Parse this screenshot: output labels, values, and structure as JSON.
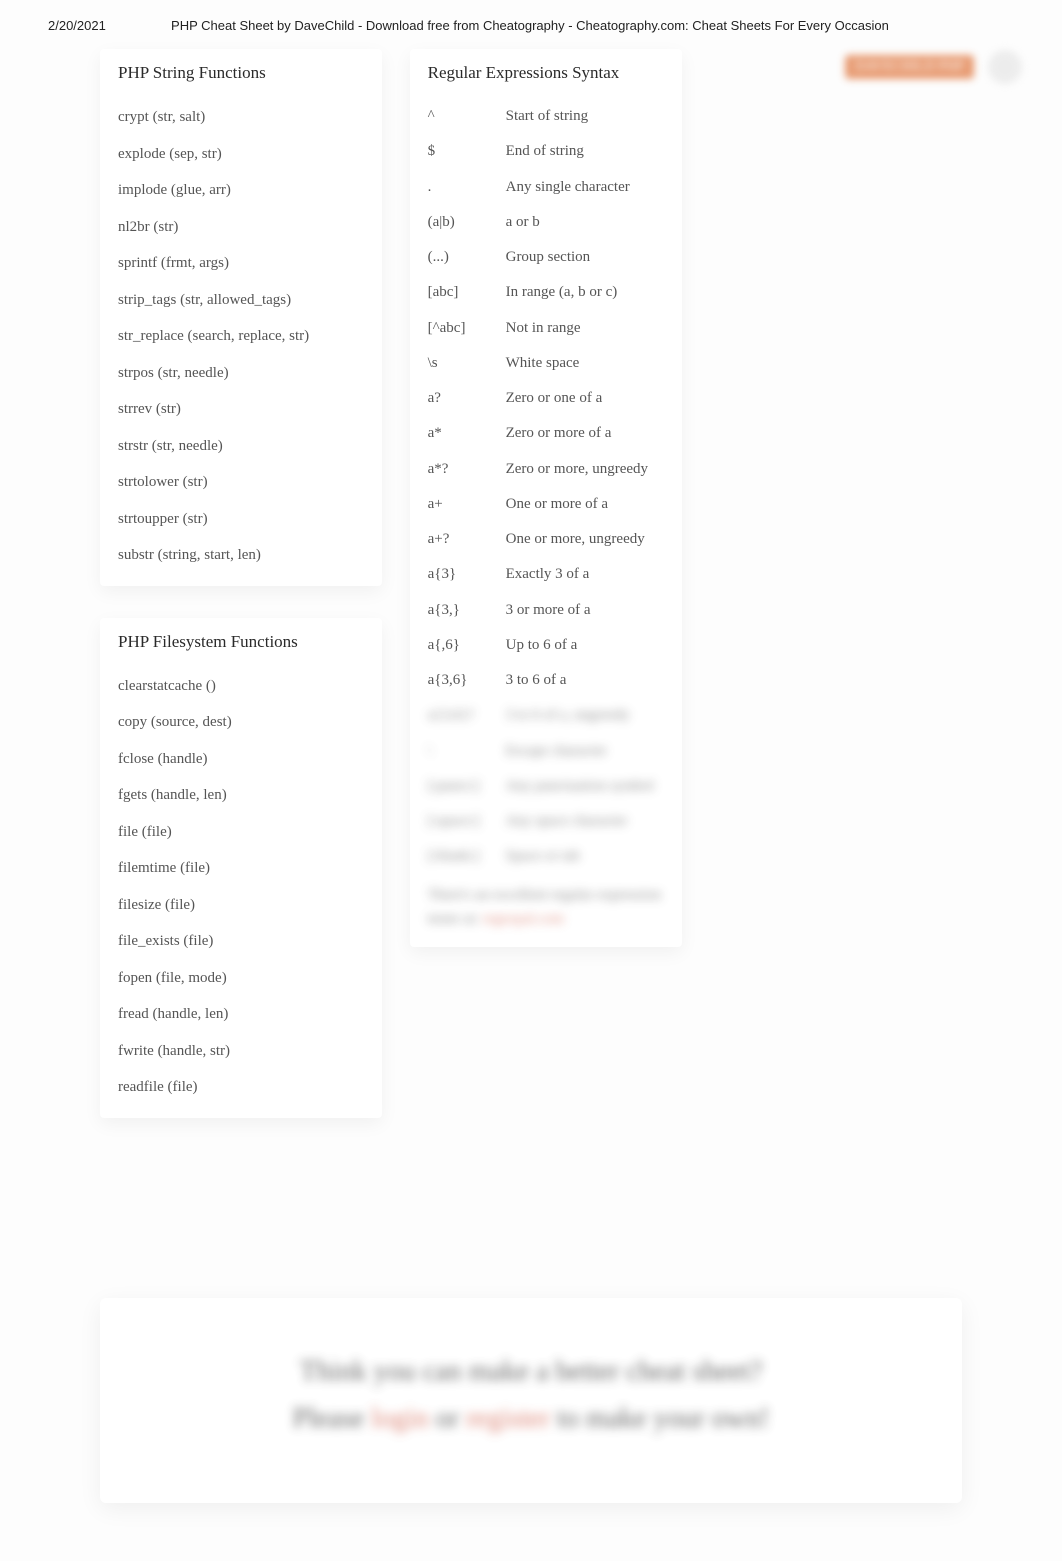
{
  "header": {
    "date": "2/20/2021",
    "title": "PHP Cheat Sheet by DaveChild - Download free from Cheatography - Cheatography.com: Cheat Sheets For Every Occasion"
  },
  "top_right_pill": "DAVECHILD PHP",
  "string_functions": {
    "title": "PHP String Functions",
    "items": [
      "crypt (str, salt)",
      "explode (sep, str)",
      "implode (glue, arr)",
      "nl2br (str)",
      "sprintf (frmt, args)",
      "strip_tags (str, allowed_tags)",
      "str_replace (search, replace, str)",
      "strpos (str, needle)",
      "strrev (str)",
      "strstr (str, needle)",
      "strtolower (str)",
      "strtoupper (str)",
      "substr (string, start, len)"
    ]
  },
  "filesystem_functions": {
    "title": "PHP Filesystem Functions",
    "items": [
      "clearstatcache ()",
      "copy (source, dest)",
      "fclose (handle)",
      "fgets (handle, len)",
      "file (file)",
      "filemtime (file)",
      "filesize (file)",
      "file_exists (file)",
      "fopen (file, mode)",
      "fread (handle, len)",
      "fwrite (handle, str)",
      "readfile (file)"
    ]
  },
  "regex": {
    "title": "Regular Expressions Syntax",
    "rows": [
      {
        "k": "^",
        "v": "Start of string"
      },
      {
        "k": "$",
        "v": "End of string"
      },
      {
        "k": ".",
        "v": "Any single character"
      },
      {
        "k": "(a|b)",
        "v": "a or b"
      },
      {
        "k": "(...)",
        "v": "Group section"
      },
      {
        "k": "[abc]",
        "v": "In range (a, b or c)"
      },
      {
        "k": "[^abc]",
        "v": "Not in range"
      },
      {
        "k": "\\s",
        "v": "White space"
      },
      {
        "k": "a?",
        "v": "Zero or one of a"
      },
      {
        "k": "a*",
        "v": "Zero or more of a"
      },
      {
        "k": "a*?",
        "v": "Zero or more, ungreedy"
      },
      {
        "k": "a+",
        "v": "One or more of a"
      },
      {
        "k": "a+?",
        "v": "One or more, ungreedy"
      },
      {
        "k": "a{3}",
        "v": "Exactly 3 of a"
      },
      {
        "k": "a{3,}",
        "v": "3 or more of a"
      },
      {
        "k": "a{,6}",
        "v": "Up to 6 of a"
      },
      {
        "k": "a{3,6}",
        "v": "3 to 6 of a"
      }
    ],
    "blurred_rows": [
      {
        "k": "a{3,6}?",
        "v": "3 to 6 of a, ungreedy"
      },
      {
        "k": "\\",
        "v": "Escape character"
      },
      {
        "k": "[:punct:]",
        "v": "Any punctuation symbol"
      },
      {
        "k": "[:space:]",
        "v": "Any space character"
      },
      {
        "k": "[:blank:]",
        "v": "Space or tab"
      }
    ],
    "footnote_text": "There's an excellent regular expression tester at: ",
    "footnote_link": "regexpal.com"
  },
  "cta": {
    "line1": "Think you can make a better cheat sheet?",
    "line2_pre": "Please ",
    "line2_login": "login",
    "line2_or": " or ",
    "line2_register": "register",
    "line2_post": " to make your own!"
  }
}
